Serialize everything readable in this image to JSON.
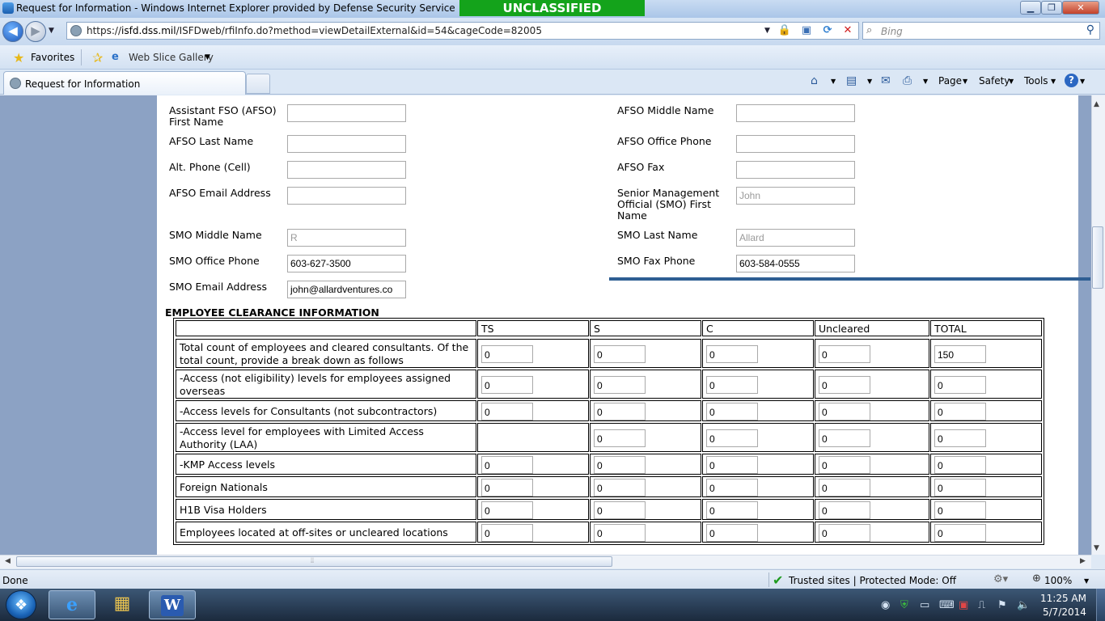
{
  "window": {
    "title": "Request for Information - Windows Internet Explorer provided by Defense Security Service",
    "banner": "UNCLASSIFIED",
    "min": "▁",
    "max": "❐",
    "close": "✕"
  },
  "nav": {
    "address_domain": "isfd.dss.mil",
    "address_prefix": "https://",
    "address_path": "/ISFDweb/rfiInfo.do?method=viewDetailExternal&id=54&cageCode=82005",
    "search_placeholder": "Bing"
  },
  "favorites": {
    "label": "Favorites",
    "web_slice": "Web Slice Gallery"
  },
  "tab": {
    "label": "Request for Information"
  },
  "commands": {
    "page": "Page",
    "safety": "Safety",
    "tools": "Tools",
    "help": "?"
  },
  "form": {
    "afso_first_label": "Assistant FSO (AFSO) First Name",
    "afso_first_value": "",
    "afso_middle_label": "AFSO Middle Name",
    "afso_middle_value": "",
    "afso_last_label": "AFSO Last Name",
    "afso_last_value": "",
    "afso_phone_label": "AFSO Office Phone",
    "afso_phone_value": "",
    "alt_phone_label": "Alt. Phone (Cell)",
    "alt_phone_value": "",
    "afso_fax_label": "AFSO Fax",
    "afso_fax_value": "",
    "afso_email_label": "AFSO Email Address",
    "afso_email_value": "",
    "smo_first_label": "Senior Management Official (SMO) First Name",
    "smo_first_value": "John",
    "smo_middle_label": "SMO Middle Name",
    "smo_middle_value": "R",
    "smo_last_label": "SMO Last Name",
    "smo_last_value": "Allard",
    "smo_phone_label": "SMO Office Phone",
    "smo_phone_value": "603-627-3500",
    "smo_fax_label": "SMO Fax Phone",
    "smo_fax_value": "603-584-0555",
    "smo_email_label": "SMO Email Address",
    "smo_email_value": "john@allardventures.co"
  },
  "clearance": {
    "title": "EMPLOYEE CLEARANCE INFORMATION",
    "columns": [
      "TS",
      "S",
      "C",
      "Uncleared",
      "TOTAL"
    ],
    "rows": [
      {
        "label": "Total count of employees and cleared consultants. Of the total count, provide a break down as follows",
        "values": [
          "0",
          "0",
          "0",
          "0",
          "150"
        ]
      },
      {
        "label": "-Access (not eligibility) levels for employees assigned overseas",
        "values": [
          "0",
          "0",
          "0",
          "0",
          "0"
        ]
      },
      {
        "label": "-Access levels for Consultants (not subcontractors)",
        "values": [
          "0",
          "0",
          "0",
          "0",
          "0"
        ]
      },
      {
        "label": "-Access level for employees with Limited Access Authority (LAA)",
        "values": [
          null,
          "0",
          "0",
          "0",
          "0"
        ]
      },
      {
        "label": "-KMP Access levels",
        "values": [
          "0",
          "0",
          "0",
          "0",
          "0"
        ]
      },
      {
        "label": "Foreign Nationals",
        "values": [
          "0",
          "0",
          "0",
          "0",
          "0"
        ]
      },
      {
        "label": "H1B Visa Holders",
        "values": [
          "0",
          "0",
          "0",
          "0",
          "0"
        ]
      },
      {
        "label": "Employees located at off-sites or uncleared locations",
        "values": [
          "0",
          "0",
          "0",
          "0",
          "0"
        ]
      }
    ]
  },
  "status": {
    "text": "Done",
    "zone": "Trusted sites | Protected Mode: Off",
    "zoom": "100%"
  },
  "taskbar": {
    "time": "11:25 AM",
    "date": "5/7/2014"
  },
  "colors": {
    "banner_green": "#14a31b",
    "side_panel": "#8ca2c4",
    "rule_blue": "#2e5e93"
  }
}
